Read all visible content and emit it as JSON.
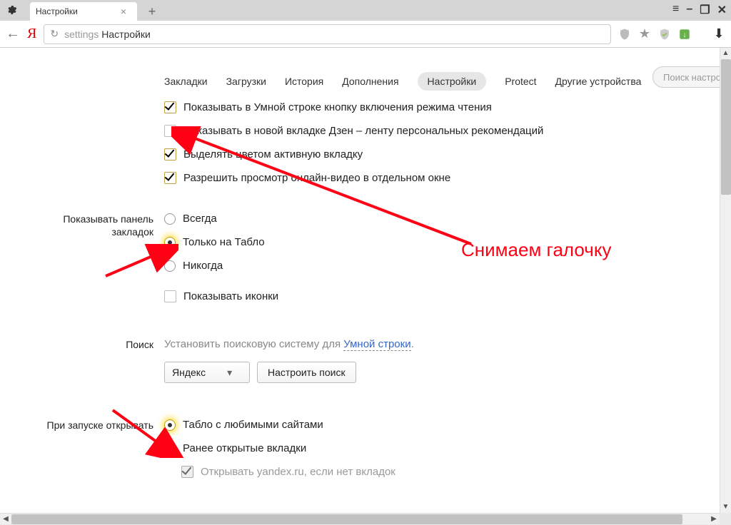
{
  "window": {
    "tab_title": "Настройки",
    "new_tab_glyph": "+",
    "menu_glyph": "≡",
    "min_glyph": "–",
    "max_glyph": "❐",
    "close_glyph": "✕"
  },
  "addr": {
    "back_glyph": "←",
    "yandex_logo": "Я",
    "reload_glyph": "↻",
    "url_prefix": "settings",
    "url_tail": " Настройки",
    "star_glyph": "★",
    "download_glyph": "⬇"
  },
  "nav": {
    "items": [
      "Закладки",
      "Загрузки",
      "История",
      "Дополнения",
      "Настройки",
      "Protect",
      "Другие устройства"
    ],
    "active_index": 4,
    "search_placeholder": "Поиск настроек"
  },
  "settings": {
    "top_checks": [
      {
        "label": "Показывать в Умной строке кнопку включения режима чтения",
        "checked": true
      },
      {
        "label": "Показывать в новой вкладке Дзен – ленту персональных рекомендаций",
        "checked": false
      },
      {
        "label": "Выделять цветом активную вкладку",
        "checked": true
      },
      {
        "label": "Разрешить просмотр онлайн-видео в отдельном окне",
        "checked": true
      }
    ],
    "bookmarks_panel": {
      "title": "Показывать панель закладок",
      "options": [
        "Всегда",
        "Только на Табло",
        "Никогда"
      ],
      "selected_index": 1,
      "show_icons_label": "Показывать иконки",
      "show_icons_checked": false
    },
    "search": {
      "title": "Поиск",
      "desc_pre": "Установить поисковую систему для ",
      "desc_link": "Умной строки",
      "desc_post": ".",
      "engine": "Яндекс",
      "configure_btn": "Настроить поиск"
    },
    "startup": {
      "title": "При запуске открывать",
      "options": [
        "Табло с любимыми сайтами",
        "Ранее открытые вкладки"
      ],
      "selected_index": 0,
      "open_yandex_label": "Открывать yandex.ru, если нет вкладок",
      "open_yandex_checked": true
    }
  },
  "annotation": {
    "text": "Снимаем галочку"
  }
}
